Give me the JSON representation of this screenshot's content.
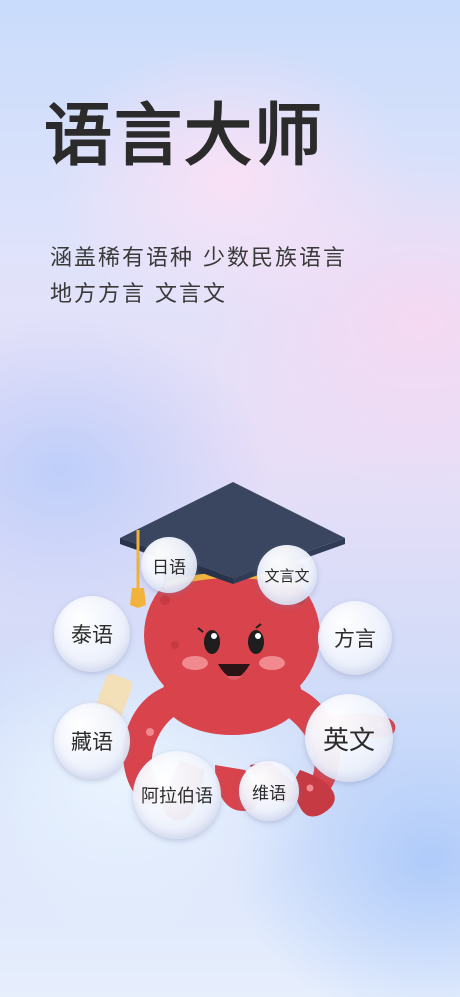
{
  "header": {
    "title": "语言大师",
    "subtitle_line1": "涵盖稀有语种 少数民族语言",
    "subtitle_line2": "地方方言 文言文"
  },
  "bubbles": {
    "japanese": "日语",
    "classical": "文言文",
    "thai": "泰语",
    "dialect": "方言",
    "tibetan": "藏语",
    "english": "英文",
    "arabic": "阿拉伯语",
    "uyghur": "维语"
  },
  "colors": {
    "octopus": "#d9434c",
    "cap": "#3a4660",
    "tassel": "#f2b33d"
  }
}
